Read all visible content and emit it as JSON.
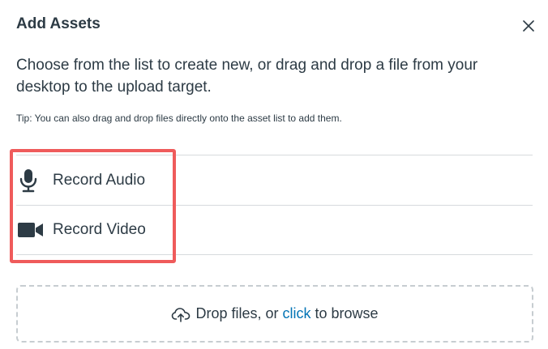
{
  "dialog": {
    "title": "Add Assets",
    "close_icon": "close-icon"
  },
  "body": {
    "description": "Choose from the list to create new, or drag and drop a file from your desktop to the upload target.",
    "tip": "Tip: You can also drag and drop files directly onto the asset list to add them."
  },
  "options": [
    {
      "label": "Record Audio",
      "icon": "microphone-icon"
    },
    {
      "label": "Record Video",
      "icon": "video-camera-icon"
    }
  ],
  "dropzone": {
    "prefix": "Drop files, or",
    "link": "click",
    "suffix": "to browse",
    "icon": "cloud-upload-icon"
  },
  "colors": {
    "text": "#2d3b45",
    "link": "#0374b5",
    "highlight": "#ef5b5b",
    "divider": "#d7dadd"
  }
}
